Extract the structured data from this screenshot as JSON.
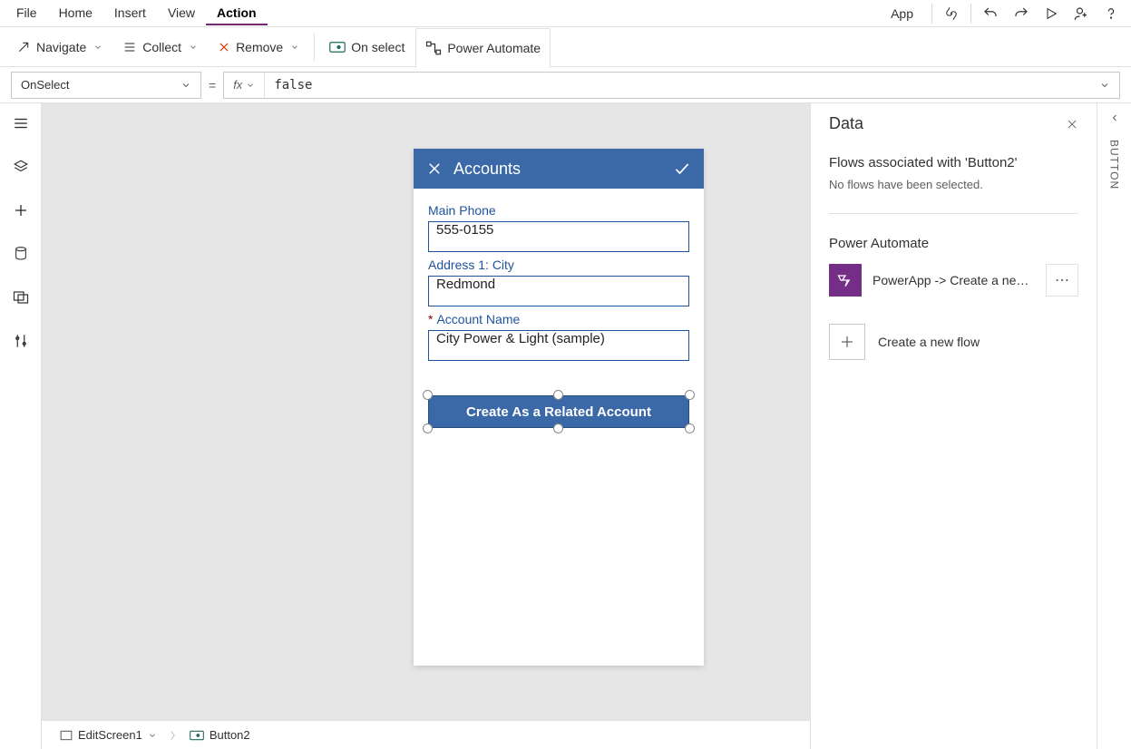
{
  "menu": {
    "items": [
      "File",
      "Home",
      "Insert",
      "View",
      "Action"
    ],
    "activeIndex": 4,
    "appLabel": "App"
  },
  "ribbon": {
    "navigate": "Navigate",
    "collect": "Collect",
    "remove": "Remove",
    "onselect": "On select",
    "powerautomate": "Power Automate"
  },
  "formula": {
    "property": "OnSelect",
    "expression": "false"
  },
  "phone": {
    "title": "Accounts",
    "fields": {
      "mainPhone": {
        "label": "Main Phone",
        "value": "555-0155"
      },
      "city": {
        "label": "Address 1: City",
        "value": "Redmond"
      },
      "account": {
        "label": "Account Name",
        "value": "City Power & Light (sample)"
      }
    },
    "buttonLabel": "Create As a Related Account"
  },
  "breadcrumb": {
    "screen": "EditScreen1",
    "control": "Button2"
  },
  "dataPane": {
    "title": "Data",
    "assocTitle": "Flows associated with 'Button2'",
    "assocSub": "No flows have been selected.",
    "paTitle": "Power Automate",
    "flowName": "PowerApp -> Create a new …",
    "newFlow": "Create a new flow"
  },
  "rightRail": {
    "label": "BUTTON"
  }
}
